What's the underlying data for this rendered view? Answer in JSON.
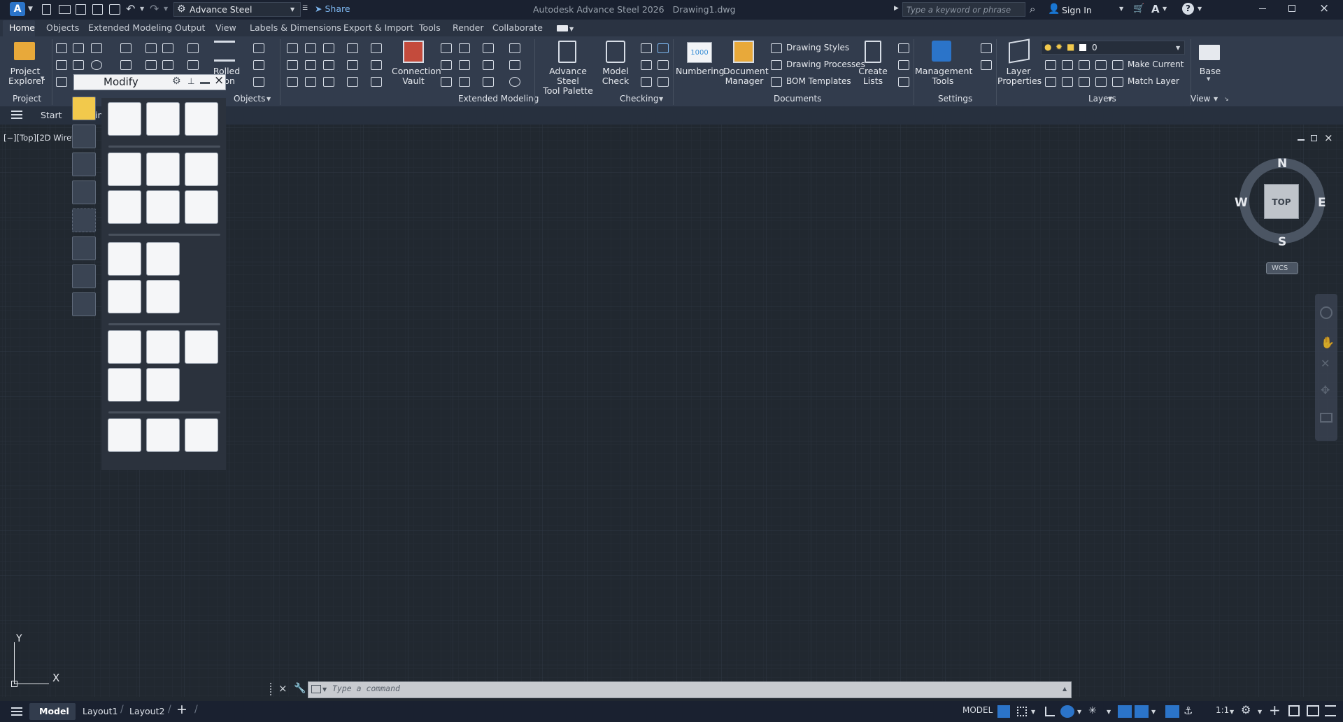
{
  "app": {
    "title": "Autodesk Advance Steel 2026",
    "file": "Drawing1.dwg",
    "logo": "A",
    "workspace": "Advance Steel",
    "share": "Share",
    "search_placeholder": "Type a keyword or phrase",
    "sign_in": "Sign In"
  },
  "tabs": [
    "Home",
    "Objects",
    "Extended Modeling",
    "Output",
    "View",
    "Labels & Dimensions",
    "Export & Import",
    "Tools",
    "Render",
    "Collaborate"
  ],
  "ribbon": {
    "panels": [
      "Project",
      "Objects",
      "Extended Modeling",
      "Checking",
      "Documents",
      "Settings",
      "Layers",
      "View"
    ],
    "project_explorer": "Project\nExplorer",
    "rolled_section": "Rolled\ntion",
    "connection_vault": "Connection\nVault",
    "tool_palette": "Advance Steel\nTool Palette",
    "model_check": "Model\nCheck",
    "numbering": "Numbering",
    "numbering_badge": "1000",
    "document_manager": "Document\nManager",
    "drawing_styles": "Drawing Styles",
    "drawing_processes": "Drawing Processes",
    "bom_templates": "BOM Templates",
    "create_lists": "Create\nLists",
    "management_tools": "Management\nTools",
    "layer_properties": "Layer\nProperties",
    "layer_value": "0",
    "make_current": "Make Current",
    "match_layer": "Match Layer",
    "base": "Base"
  },
  "doc_tabs": {
    "start": "Start",
    "partial": "ing"
  },
  "viewport_label": "[−][Top][2D Wirefr",
  "modify_title": "Modify",
  "viewcube": {
    "north": "N",
    "south": "S",
    "east": "E",
    "west": "W",
    "top": "TOP",
    "wcs": "WCS"
  },
  "ucs": {
    "x": "X",
    "y": "Y"
  },
  "command_placeholder": "Type a command",
  "layouts": [
    "Model",
    "Layout1",
    "Layout2"
  ],
  "status": {
    "model": "MODEL",
    "scale": "1:1"
  },
  "colors": {
    "accent": "#3a8fd6",
    "background": "#212830",
    "ribbon": "#323c4d"
  }
}
